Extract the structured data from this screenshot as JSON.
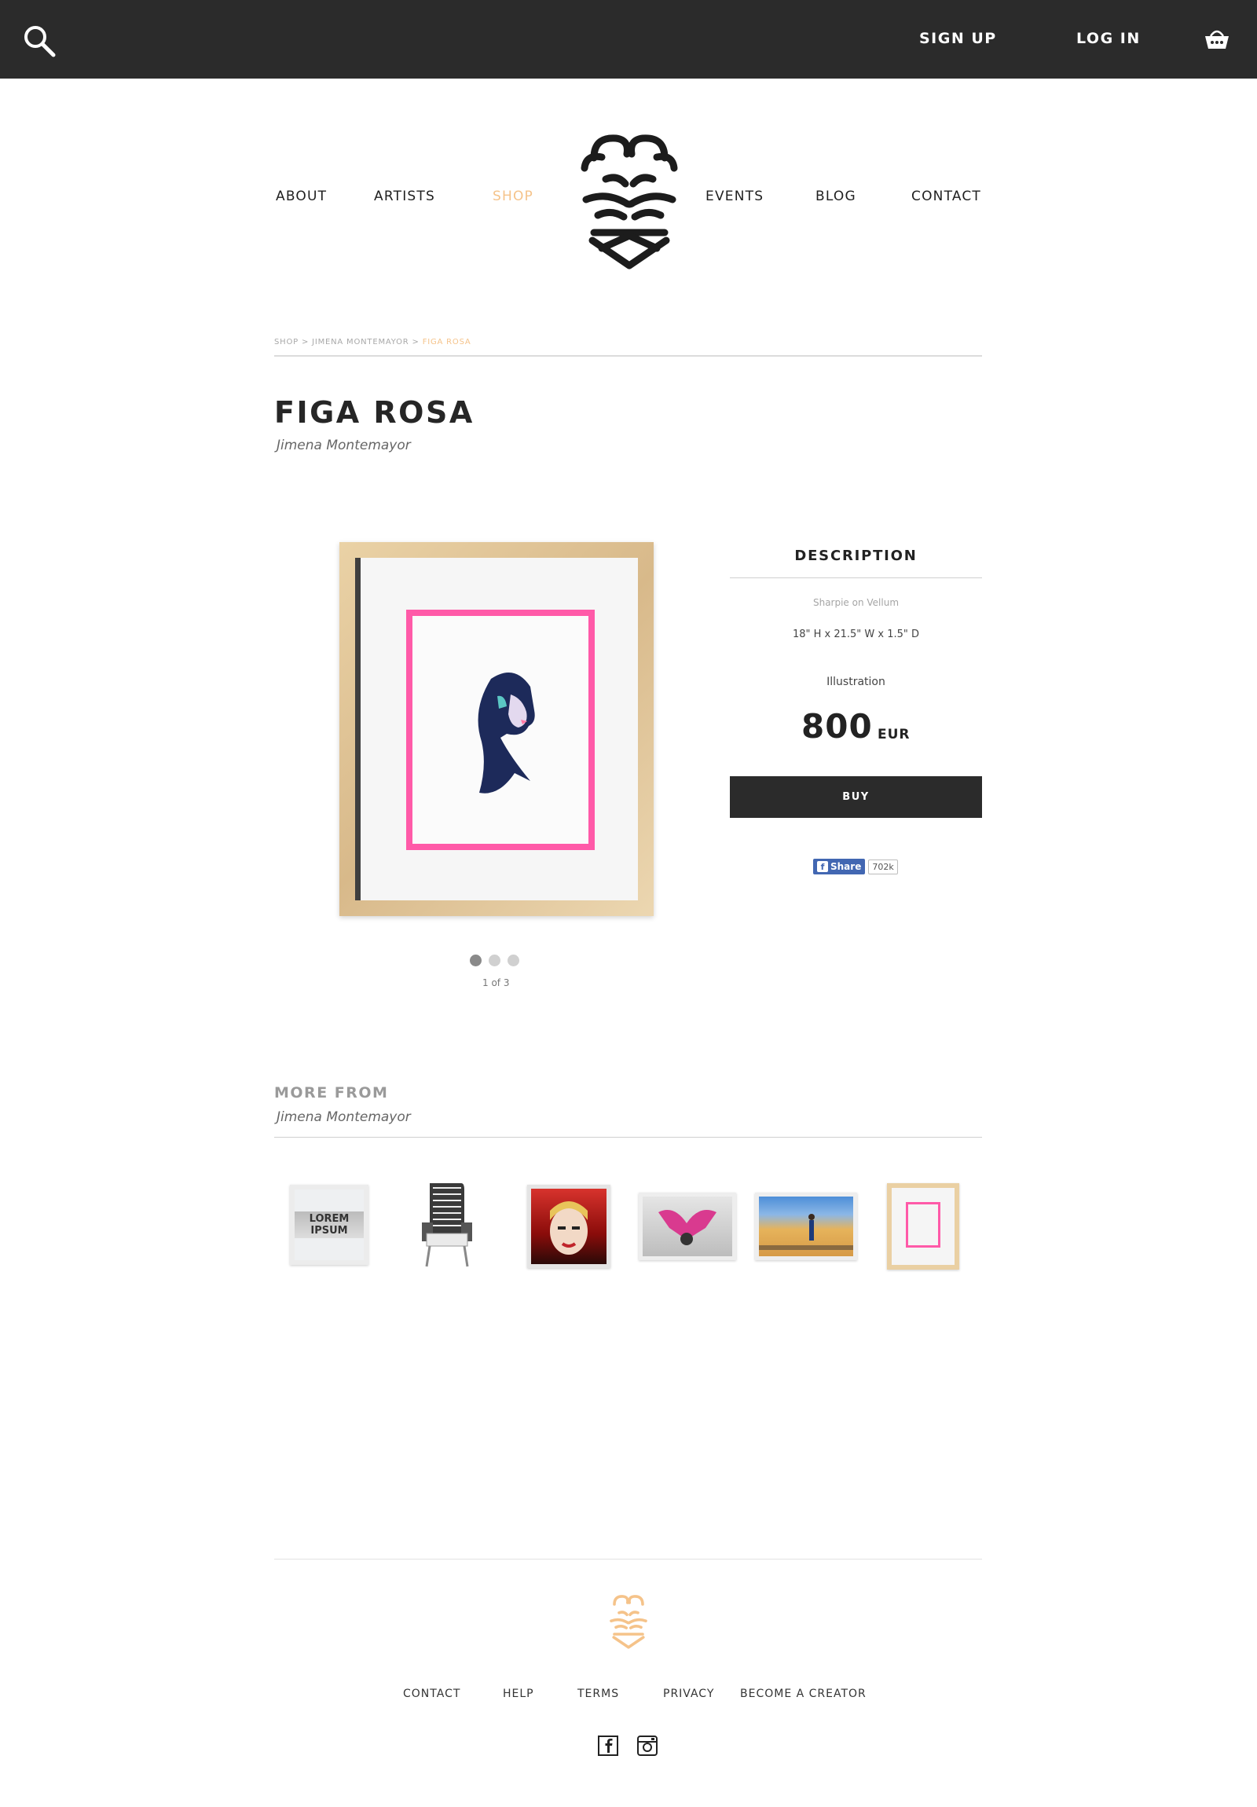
{
  "topbar": {
    "signup": "SIGN UP",
    "login": "LOG IN"
  },
  "nav": {
    "about": "ABOUT",
    "artists": "ARTISTS",
    "shop": "SHOP",
    "events": "EVENTS",
    "blog": "BLOG",
    "contact": "CONTACT"
  },
  "breadcrumb": {
    "items": [
      "SHOP",
      "JIMENA MONTEMAYOR",
      "FIGA ROSA"
    ],
    "separator": " > "
  },
  "product": {
    "title": "FIGA ROSA",
    "artist": "Jimena Montemayor",
    "gallery_counter": "1 of 3",
    "gallery_total": 3,
    "gallery_current": 1
  },
  "description": {
    "heading": "DESCRIPTION",
    "medium": "Sharpie on Vellum",
    "dimensions": "18\" H x 21.5\" W  x 1.5\" D",
    "category": "Illustration",
    "price": "800",
    "currency": "EUR",
    "buy_label": "BUY",
    "share_label": "Share",
    "share_count": "702k"
  },
  "more_from": {
    "title": "MORE FROM",
    "artist": "Jimena Montemayor",
    "thumb1_text": "LOREM IPSUM"
  },
  "footer": {
    "contact": "CONTACT",
    "help": "HELP",
    "terms": "TERMS",
    "privacy": "PRIVACY",
    "become_creator": "BECOME A CREATOR"
  },
  "colors": {
    "topbar_bg": "#2b2b2b",
    "accent": "#f5c38a",
    "frame_pink": "#ff5aa8",
    "fb_blue": "#4267b2"
  },
  "icons": {
    "search": "search-icon",
    "cart": "basket-icon",
    "facebook": "facebook-icon",
    "instagram": "instagram-icon"
  }
}
